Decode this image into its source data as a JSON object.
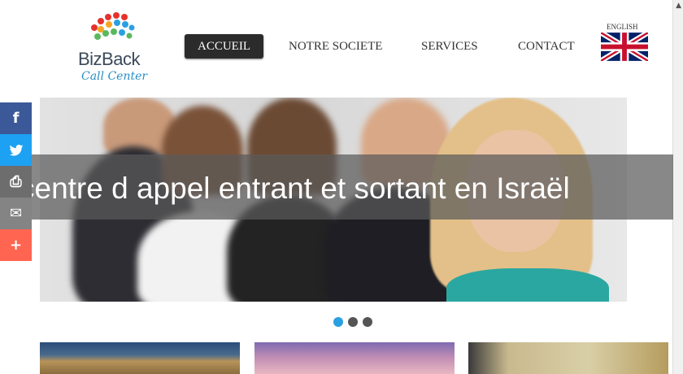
{
  "logo": {
    "name": "BizBack",
    "tagline": "Call Center"
  },
  "nav": {
    "items": [
      {
        "label": "ACCUEIL",
        "active": true
      },
      {
        "label": "NOTRE SOCIETE",
        "active": false
      },
      {
        "label": "SERVICES",
        "active": false
      },
      {
        "label": "CONTACT",
        "active": false
      }
    ],
    "language_label": "ENGLISH"
  },
  "hero": {
    "caption": "centre d appel entrant et sortant en Israël",
    "slide_count": 3,
    "active_slide": 1
  },
  "share": {
    "buttons": [
      {
        "icon": "facebook-icon",
        "glyph": "f",
        "color": "#3b5998"
      },
      {
        "icon": "twitter-icon",
        "glyph": "t",
        "color": "#1da1f2"
      },
      {
        "icon": "print-icon",
        "glyph": "⎙",
        "color": "#6d6d6d"
      },
      {
        "icon": "email-icon",
        "glyph": "✉",
        "color": "#848484"
      },
      {
        "icon": "more-icon",
        "glyph": "+",
        "color": "#ff6550"
      }
    ]
  },
  "colors": {
    "accent": "#2aa0e0",
    "nav_active": "#2b2b2b"
  }
}
